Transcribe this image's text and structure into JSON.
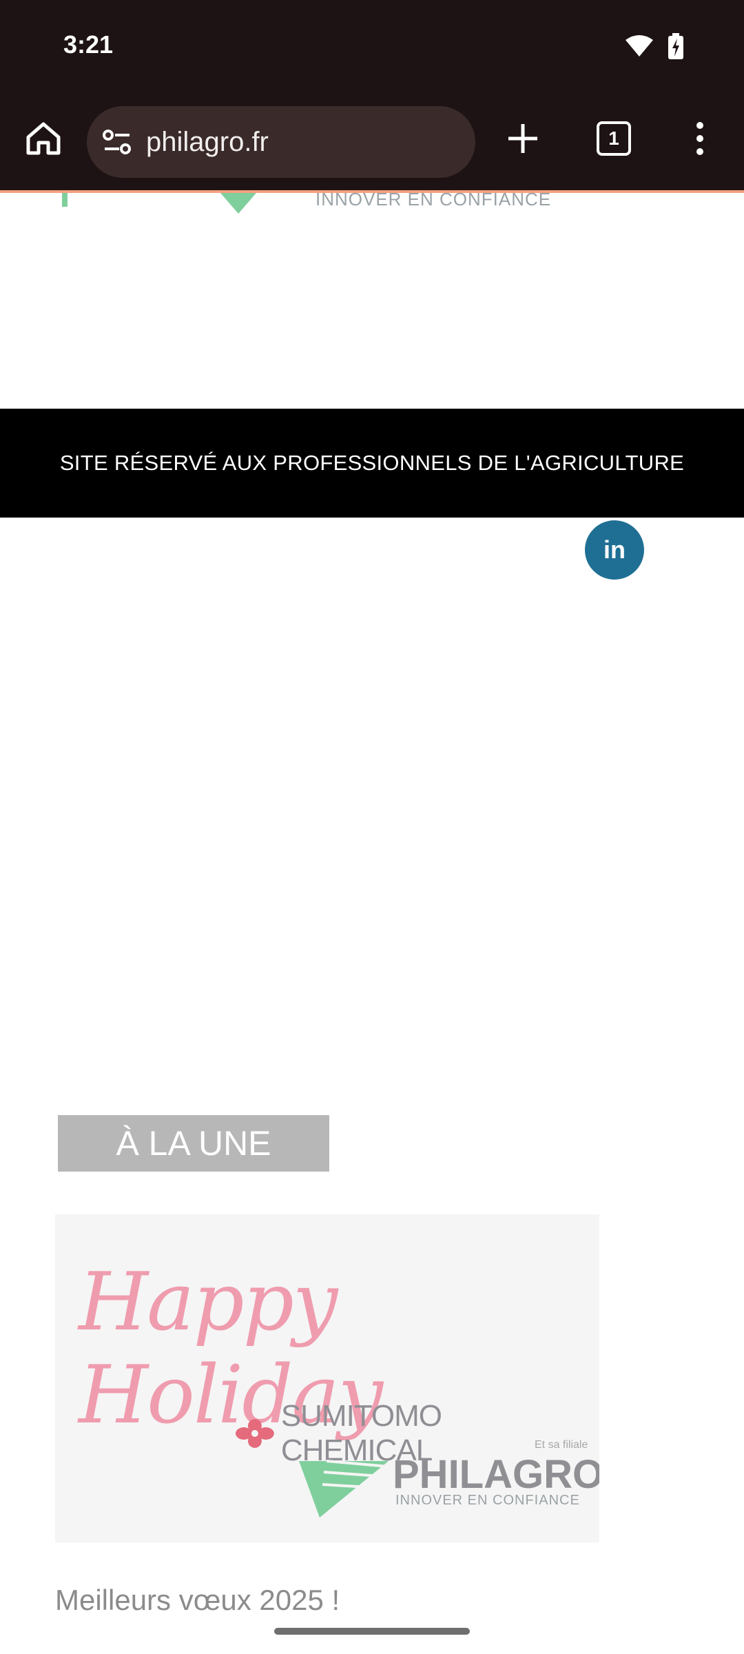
{
  "status_bar": {
    "time": "3:21",
    "icons": [
      "wifi-icon",
      "battery-charging-icon"
    ]
  },
  "browser": {
    "url": "philagro.fr",
    "tab_count": "1",
    "icons": [
      "home-icon",
      "site-settings-icon",
      "new-tab-icon",
      "tab-switcher-icon",
      "more-vertical-icon"
    ]
  },
  "header": {
    "logo_tagline": "INNOVER EN CONFIANCE"
  },
  "banner": {
    "text": "SITE RÉSERVÉ AUX PROFESSIONNELS DE L'AGRICULTURE"
  },
  "social": {
    "linkedin_label": "in"
  },
  "featured": {
    "section_label": "À LA UNE",
    "card": {
      "greeting": "Happy Holiday",
      "company": "SUMITOMO CHEMICAL",
      "subsidiary_note": "Et sa filiale",
      "brand": "PHILAGRO",
      "brand_tagline": "INNOVER EN CONFIANCE"
    },
    "article_title": "Meilleurs vœux 2025 !"
  },
  "colors": {
    "chrome_bg": "#1e1314",
    "banner_bg": "#000000",
    "linkedin": "#1f6f94",
    "brand_green": "#7fcf9c",
    "holiday_pink": "#ef9cae",
    "sumitomo_red": "#e46a7c"
  }
}
